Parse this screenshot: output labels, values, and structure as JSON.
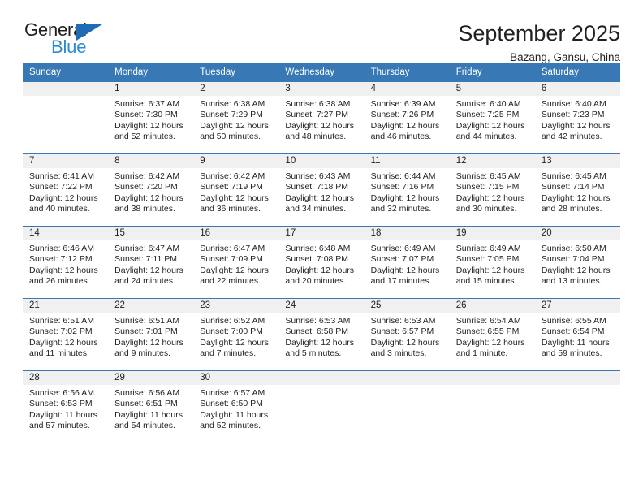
{
  "logo": {
    "word_one": "General",
    "word_two": "Blue",
    "triangle_icon": "blue-triangle-icon",
    "accent_dark": "#1f6cb5",
    "accent_light": "#2e8bd0"
  },
  "header": {
    "title": "September 2025",
    "subtitle": "Bazang, Gansu, China"
  },
  "colors": {
    "header_row_bg": "#3878b4",
    "week_band_bg": "#f0f0f0",
    "text": "#231f20"
  },
  "weekdays": [
    "Sunday",
    "Monday",
    "Tuesday",
    "Wednesday",
    "Thursday",
    "Friday",
    "Saturday"
  ],
  "weeks": [
    [
      {
        "day": "",
        "lines": []
      },
      {
        "day": "1",
        "lines": [
          "Sunrise: 6:37 AM",
          "Sunset: 7:30 PM",
          "Daylight: 12 hours",
          "and 52 minutes."
        ]
      },
      {
        "day": "2",
        "lines": [
          "Sunrise: 6:38 AM",
          "Sunset: 7:29 PM",
          "Daylight: 12 hours",
          "and 50 minutes."
        ]
      },
      {
        "day": "3",
        "lines": [
          "Sunrise: 6:38 AM",
          "Sunset: 7:27 PM",
          "Daylight: 12 hours",
          "and 48 minutes."
        ]
      },
      {
        "day": "4",
        "lines": [
          "Sunrise: 6:39 AM",
          "Sunset: 7:26 PM",
          "Daylight: 12 hours",
          "and 46 minutes."
        ]
      },
      {
        "day": "5",
        "lines": [
          "Sunrise: 6:40 AM",
          "Sunset: 7:25 PM",
          "Daylight: 12 hours",
          "and 44 minutes."
        ]
      },
      {
        "day": "6",
        "lines": [
          "Sunrise: 6:40 AM",
          "Sunset: 7:23 PM",
          "Daylight: 12 hours",
          "and 42 minutes."
        ]
      }
    ],
    [
      {
        "day": "7",
        "lines": [
          "Sunrise: 6:41 AM",
          "Sunset: 7:22 PM",
          "Daylight: 12 hours",
          "and 40 minutes."
        ]
      },
      {
        "day": "8",
        "lines": [
          "Sunrise: 6:42 AM",
          "Sunset: 7:20 PM",
          "Daylight: 12 hours",
          "and 38 minutes."
        ]
      },
      {
        "day": "9",
        "lines": [
          "Sunrise: 6:42 AM",
          "Sunset: 7:19 PM",
          "Daylight: 12 hours",
          "and 36 minutes."
        ]
      },
      {
        "day": "10",
        "lines": [
          "Sunrise: 6:43 AM",
          "Sunset: 7:18 PM",
          "Daylight: 12 hours",
          "and 34 minutes."
        ]
      },
      {
        "day": "11",
        "lines": [
          "Sunrise: 6:44 AM",
          "Sunset: 7:16 PM",
          "Daylight: 12 hours",
          "and 32 minutes."
        ]
      },
      {
        "day": "12",
        "lines": [
          "Sunrise: 6:45 AM",
          "Sunset: 7:15 PM",
          "Daylight: 12 hours",
          "and 30 minutes."
        ]
      },
      {
        "day": "13",
        "lines": [
          "Sunrise: 6:45 AM",
          "Sunset: 7:14 PM",
          "Daylight: 12 hours",
          "and 28 minutes."
        ]
      }
    ],
    [
      {
        "day": "14",
        "lines": [
          "Sunrise: 6:46 AM",
          "Sunset: 7:12 PM",
          "Daylight: 12 hours",
          "and 26 minutes."
        ]
      },
      {
        "day": "15",
        "lines": [
          "Sunrise: 6:47 AM",
          "Sunset: 7:11 PM",
          "Daylight: 12 hours",
          "and 24 minutes."
        ]
      },
      {
        "day": "16",
        "lines": [
          "Sunrise: 6:47 AM",
          "Sunset: 7:09 PM",
          "Daylight: 12 hours",
          "and 22 minutes."
        ]
      },
      {
        "day": "17",
        "lines": [
          "Sunrise: 6:48 AM",
          "Sunset: 7:08 PM",
          "Daylight: 12 hours",
          "and 20 minutes."
        ]
      },
      {
        "day": "18",
        "lines": [
          "Sunrise: 6:49 AM",
          "Sunset: 7:07 PM",
          "Daylight: 12 hours",
          "and 17 minutes."
        ]
      },
      {
        "day": "19",
        "lines": [
          "Sunrise: 6:49 AM",
          "Sunset: 7:05 PM",
          "Daylight: 12 hours",
          "and 15 minutes."
        ]
      },
      {
        "day": "20",
        "lines": [
          "Sunrise: 6:50 AM",
          "Sunset: 7:04 PM",
          "Daylight: 12 hours",
          "and 13 minutes."
        ]
      }
    ],
    [
      {
        "day": "21",
        "lines": [
          "Sunrise: 6:51 AM",
          "Sunset: 7:02 PM",
          "Daylight: 12 hours",
          "and 11 minutes."
        ]
      },
      {
        "day": "22",
        "lines": [
          "Sunrise: 6:51 AM",
          "Sunset: 7:01 PM",
          "Daylight: 12 hours",
          "and 9 minutes."
        ]
      },
      {
        "day": "23",
        "lines": [
          "Sunrise: 6:52 AM",
          "Sunset: 7:00 PM",
          "Daylight: 12 hours",
          "and 7 minutes."
        ]
      },
      {
        "day": "24",
        "lines": [
          "Sunrise: 6:53 AM",
          "Sunset: 6:58 PM",
          "Daylight: 12 hours",
          "and 5 minutes."
        ]
      },
      {
        "day": "25",
        "lines": [
          "Sunrise: 6:53 AM",
          "Sunset: 6:57 PM",
          "Daylight: 12 hours",
          "and 3 minutes."
        ]
      },
      {
        "day": "26",
        "lines": [
          "Sunrise: 6:54 AM",
          "Sunset: 6:55 PM",
          "Daylight: 12 hours",
          "and 1 minute."
        ]
      },
      {
        "day": "27",
        "lines": [
          "Sunrise: 6:55 AM",
          "Sunset: 6:54 PM",
          "Daylight: 11 hours",
          "and 59 minutes."
        ]
      }
    ],
    [
      {
        "day": "28",
        "lines": [
          "Sunrise: 6:56 AM",
          "Sunset: 6:53 PM",
          "Daylight: 11 hours",
          "and 57 minutes."
        ]
      },
      {
        "day": "29",
        "lines": [
          "Sunrise: 6:56 AM",
          "Sunset: 6:51 PM",
          "Daylight: 11 hours",
          "and 54 minutes."
        ]
      },
      {
        "day": "30",
        "lines": [
          "Sunrise: 6:57 AM",
          "Sunset: 6:50 PM",
          "Daylight: 11 hours",
          "and 52 minutes."
        ]
      },
      {
        "day": "",
        "lines": []
      },
      {
        "day": "",
        "lines": []
      },
      {
        "day": "",
        "lines": []
      },
      {
        "day": "",
        "lines": []
      }
    ]
  ]
}
